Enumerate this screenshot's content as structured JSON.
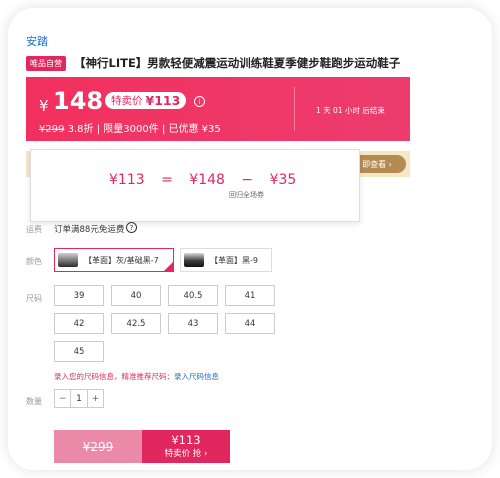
{
  "brand": "安踏",
  "product": {
    "tag": "唯品自营",
    "title": "【神行LITE】男款轻便减震运动训练鞋夏季健步鞋跑步运动鞋子"
  },
  "price_banner": {
    "currency": "¥",
    "price": "148",
    "badge_label": "特卖价",
    "badge_price": "¥113",
    "info_icon": "info-icon",
    "original_price": "¥299",
    "discount": "3.8折",
    "limit": "限量3000件",
    "saved": "已优惠 ¥35",
    "countdown": "1 天 01 小时 后结束",
    "bg_color": "#f2305f"
  },
  "coupon_strip": {
    "button": "即查看 ›"
  },
  "popup": {
    "final": "¥113",
    "eq": "=",
    "base": "¥148",
    "minus": "−",
    "discount": "¥35",
    "discount_note": "回归全场券"
  },
  "shipping": {
    "label": "运费",
    "text": "订单满88元免运费",
    "help_icon": "question-circle-icon"
  },
  "color": {
    "label": "颜色",
    "options": [
      "【革面】灰/基础黑-7",
      "【革面】黑-9"
    ],
    "selected_index": 0
  },
  "size": {
    "label": "尺码",
    "options": [
      "39",
      "40",
      "40.5",
      "41",
      "42",
      "42.5",
      "43",
      "44",
      "45"
    ]
  },
  "size_hint": {
    "text": "录入您的尺码信息，精准推荐尺码：",
    "link": "录入尺码信息"
  },
  "quantity": {
    "label": "数量",
    "minus": "−",
    "value": "1",
    "plus": "+"
  },
  "buy": {
    "original": "¥299",
    "price": "¥113",
    "action": "特卖价 抢 ›"
  },
  "accent_color": "#e2275e"
}
